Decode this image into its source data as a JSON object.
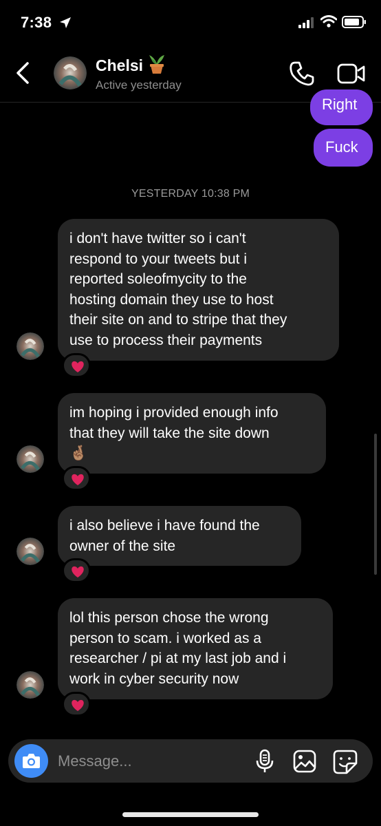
{
  "status": {
    "time": "7:38"
  },
  "header": {
    "name": "Chelsi",
    "activity": "Active yesterday"
  },
  "outgoing": [
    {
      "text": "Right"
    },
    {
      "text": "Fuck"
    }
  ],
  "timestamp": "YESTERDAY 10:38 PM",
  "incoming": [
    {
      "text": "i don't have twitter so i can't\nrespond to your tweets but i\nreported soleofmycity to the\nhosting domain they use to host\ntheir site on and to stripe that they\nuse to process their payments",
      "reaction": "❤️"
    },
    {
      "text": "im hoping i provided enough info\nthat they will take the site down\n🤞🏽",
      "reaction": "❤️"
    },
    {
      "text": "i also believe i have found the\nowner of the site",
      "reaction": "❤️"
    },
    {
      "text": "lol this person chose the wrong\nperson to scam. i worked as a\nresearcher / pi at my last job and i\nwork in cyber security now",
      "reaction": "❤️"
    }
  ],
  "composer": {
    "placeholder": "Message..."
  },
  "colors": {
    "outgoing_bubble": "#7c3fe4",
    "incoming_bubble": "#262626",
    "camera_button": "#3f8cf6",
    "reaction_heart": "#e0245e"
  },
  "icons": [
    "location-arrow-icon",
    "signal-icon",
    "wifi-icon",
    "battery-icon",
    "back-chevron-icon",
    "plant-emoji-icon",
    "phone-icon",
    "video-camera-icon",
    "camera-icon",
    "microphone-icon",
    "gallery-icon",
    "sticker-icon",
    "heart-icon"
  ]
}
